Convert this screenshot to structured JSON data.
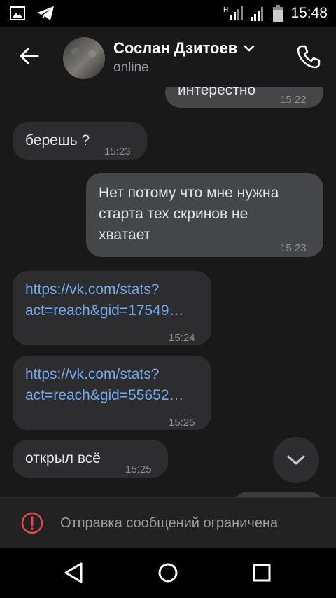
{
  "statusbar": {
    "time": "15:48",
    "network_label": "H"
  },
  "header": {
    "contact_name": "Сослан Дзитоев",
    "contact_status": "online"
  },
  "messages": [
    {
      "direction": "out",
      "text": "интерестно",
      "time": "15:22"
    },
    {
      "direction": "in",
      "text": "берешь ?",
      "time": "15:23"
    },
    {
      "direction": "out",
      "text": "Нет потому что мне нужна старта тех скринов не хватает",
      "time": "15:23"
    },
    {
      "direction": "in",
      "line1": "https://vk.com/stats?",
      "line2": "act=reach&gid=17549…",
      "time": "15:24"
    },
    {
      "direction": "in",
      "line1": "https://vk.com/stats?",
      "line2": "act=reach&gid=55652…",
      "time": "15:25"
    },
    {
      "direction": "in",
      "text": "открыл всё",
      "time": "15:25"
    }
  ],
  "message_lines": {
    "m2_line1": "Нет потому что мне нужна",
    "m2_line2": "старта тех скринов не",
    "m2_line3": "хватает"
  },
  "restriction": {
    "text": "Отправка сообщений ограничена"
  },
  "colors": {
    "background": "#19191a",
    "bubble_in": "#2d2d2f",
    "bubble_out": "#454647",
    "link": "#71aaeb",
    "warning": "#e64646"
  }
}
